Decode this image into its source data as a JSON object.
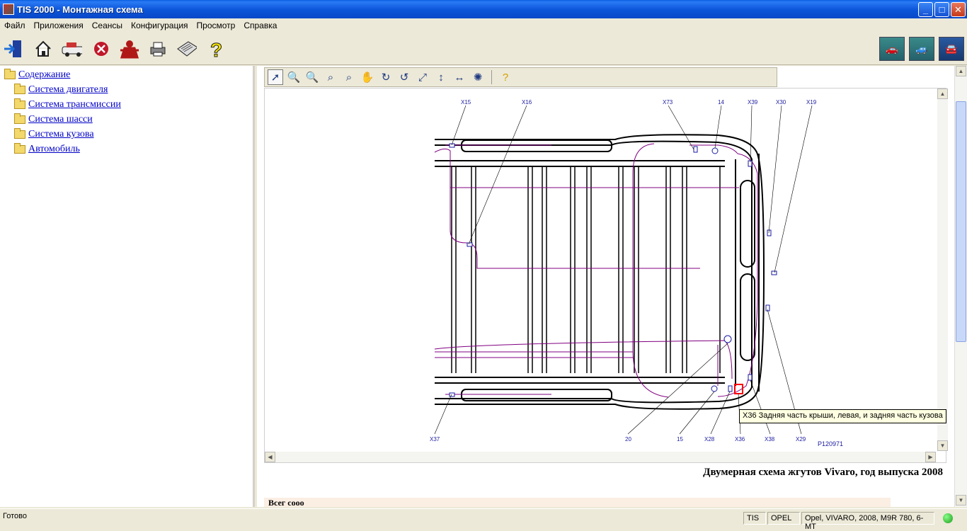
{
  "window": {
    "title": "TIS 2000 - Монтажная схема"
  },
  "menu": [
    "Файл",
    "Приложения",
    "Сеансы",
    "Конфигурация",
    "Просмотр",
    "Справка"
  ],
  "tree": {
    "root": "Содержание",
    "items": [
      "Система двигателя",
      "Система трансмиссии",
      "Система шасси",
      "Система кузова",
      "Автомобиль"
    ]
  },
  "diagram": {
    "connector_labels": {
      "top": [
        "X15",
        "X16",
        "X73",
        "14",
        "X39",
        "X30",
        "X19"
      ],
      "bottom": [
        "X37",
        "20",
        "15",
        "X28",
        "X36",
        "X38",
        "X29"
      ]
    },
    "figure_id": "P120971",
    "tooltip": "X36 Задняя часть крыши, левая, и задняя часть кузова"
  },
  "caption": "Двумерная схема жгутов Vivaro, год выпуска 2008",
  "legend_strip": "Всег сооо",
  "status": {
    "ready": "Готово",
    "tis": "TIS",
    "brand": "OPEL",
    "vehicle": "Opel, VIVARO, 2008, M9R 780, 6-MT"
  },
  "colors": {
    "wire": "#800080",
    "label": "#1a1aa0",
    "highlight": "#ff0000"
  }
}
